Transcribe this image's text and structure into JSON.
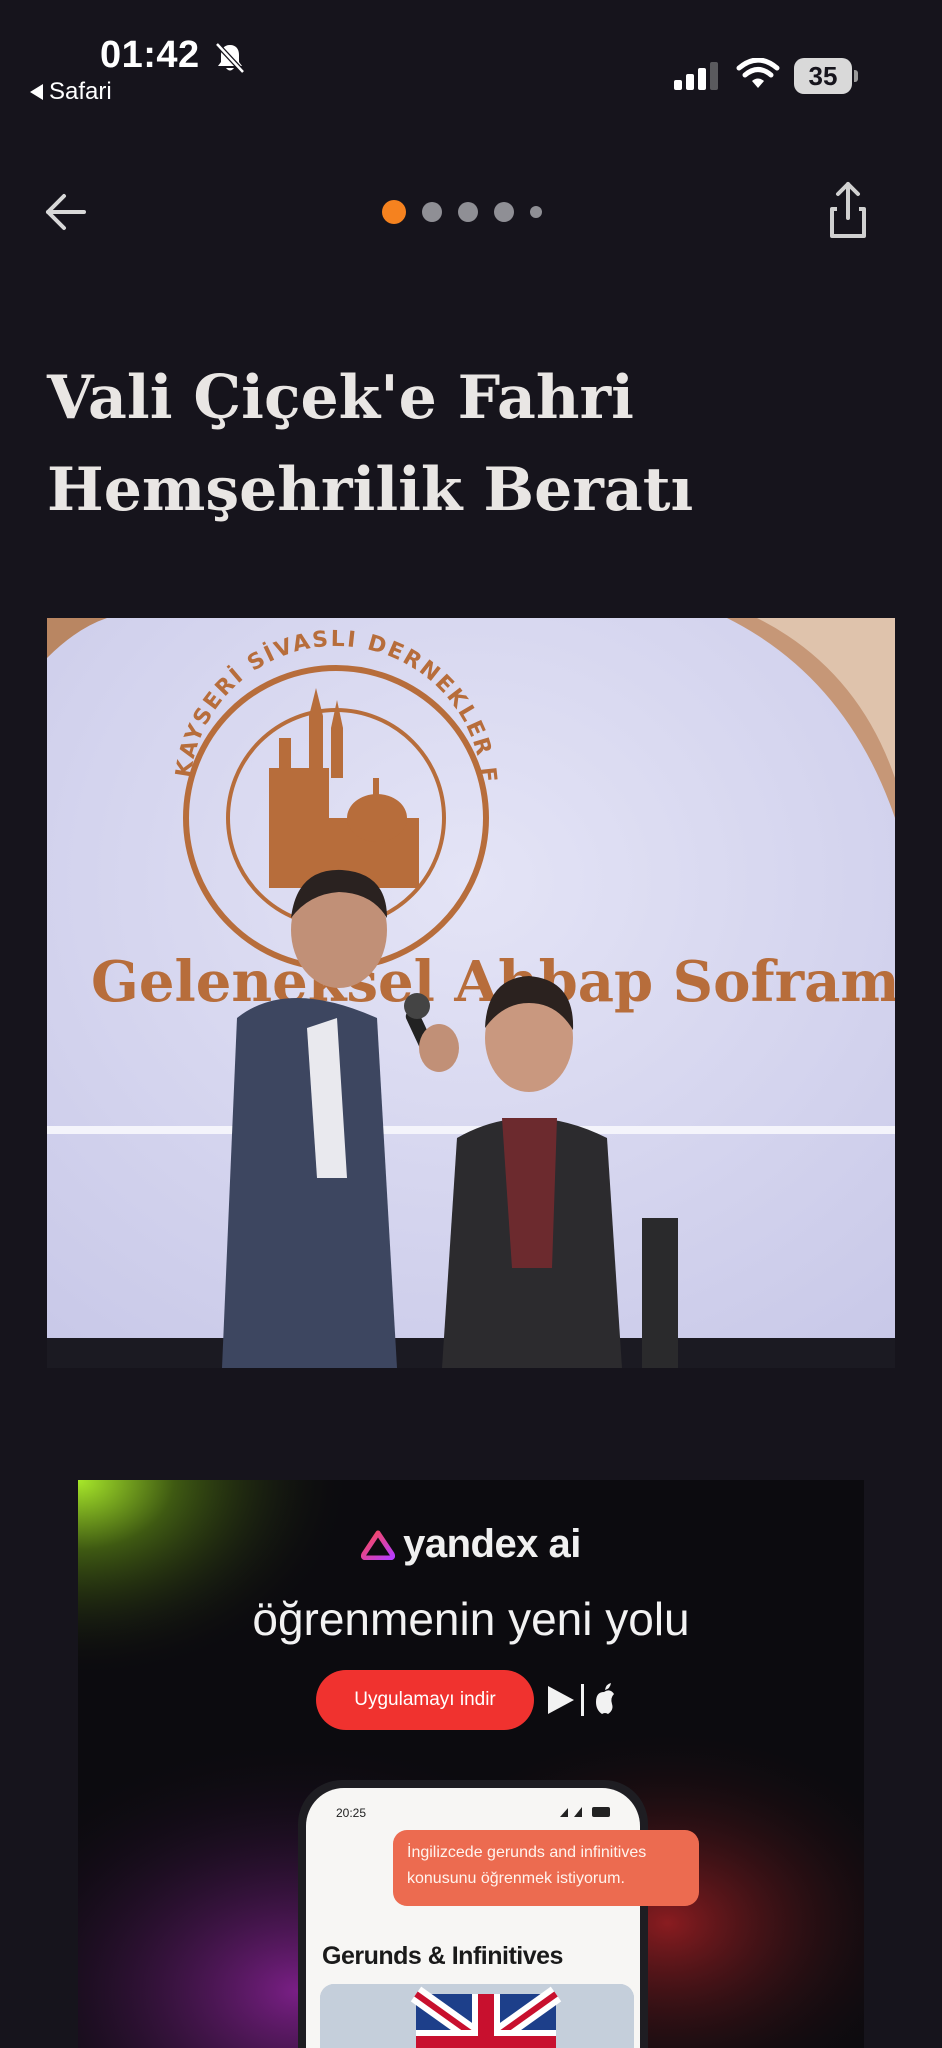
{
  "status_bar": {
    "time": "01:42",
    "back_app": "Safari",
    "battery": "35",
    "icons": [
      "bell-slash-icon",
      "cellular-signal-icon",
      "wifi-icon",
      "battery-icon"
    ]
  },
  "nav": {
    "back_icon": "arrow-left-icon",
    "share_icon": "share-icon",
    "pager": {
      "count": 5,
      "active_index": 0
    }
  },
  "article": {
    "title": "Vali Çiçek'e Fahri Hemşehrilik Beratı"
  },
  "photo": {
    "seal_text": "KAYSERİ SİVASLI DERNEKLER FEDERASYONU",
    "banner_text": "Geleneksel Ahbap Soframız'a Hoşgeldiniz"
  },
  "ad": {
    "brand": "yandex ai",
    "slogan": "öğrenmenin yeni yolu",
    "cta": "Uygulamayı indir",
    "phone": {
      "time": "20:25",
      "bubble": "İngilizcede gerunds and infinitives konusunu öğrenmek istiyorum.",
      "heading": "Gerunds & Infinitives"
    }
  },
  "colors": {
    "background": "#16141c",
    "accent": "#f5821f",
    "cta": "#f0322f"
  }
}
